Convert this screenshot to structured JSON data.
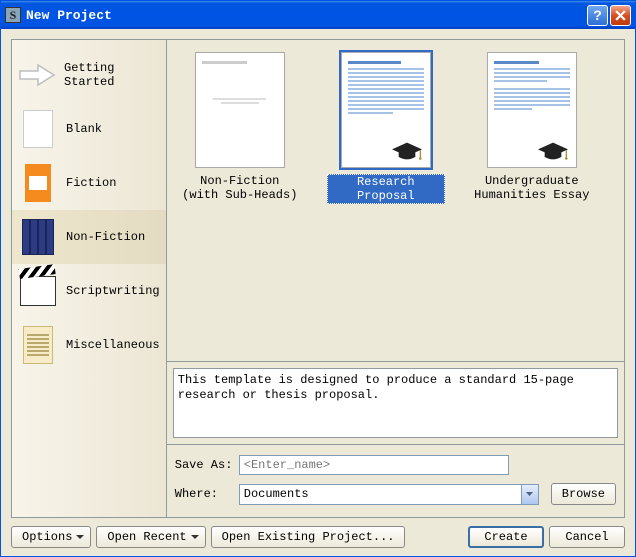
{
  "window": {
    "title": "New Project"
  },
  "sidebar": {
    "items": [
      {
        "label": "Getting Started"
      },
      {
        "label": "Blank"
      },
      {
        "label": "Fiction"
      },
      {
        "label": "Non-Fiction"
      },
      {
        "label": "Scriptwriting"
      },
      {
        "label": "Miscellaneous"
      }
    ],
    "selected_index": 3
  },
  "templates": {
    "items": [
      {
        "label": "Non-Fiction (with Sub-Heads)"
      },
      {
        "label": "Research Proposal"
      },
      {
        "label": "Undergraduate Humanities Essay"
      }
    ],
    "selected_index": 1
  },
  "description": "This template is designed to produce a standard 15-page research or thesis proposal.",
  "save": {
    "save_as_label": "Save As:",
    "save_as_placeholder": "<Enter_name>",
    "save_as_value": "",
    "where_label": "Where:",
    "where_value": "Documents",
    "browse_label": "Browse"
  },
  "footer": {
    "options_label": "Options",
    "open_recent_label": "Open Recent",
    "open_existing_label": "Open Existing Project...",
    "create_label": "Create",
    "cancel_label": "Cancel"
  }
}
